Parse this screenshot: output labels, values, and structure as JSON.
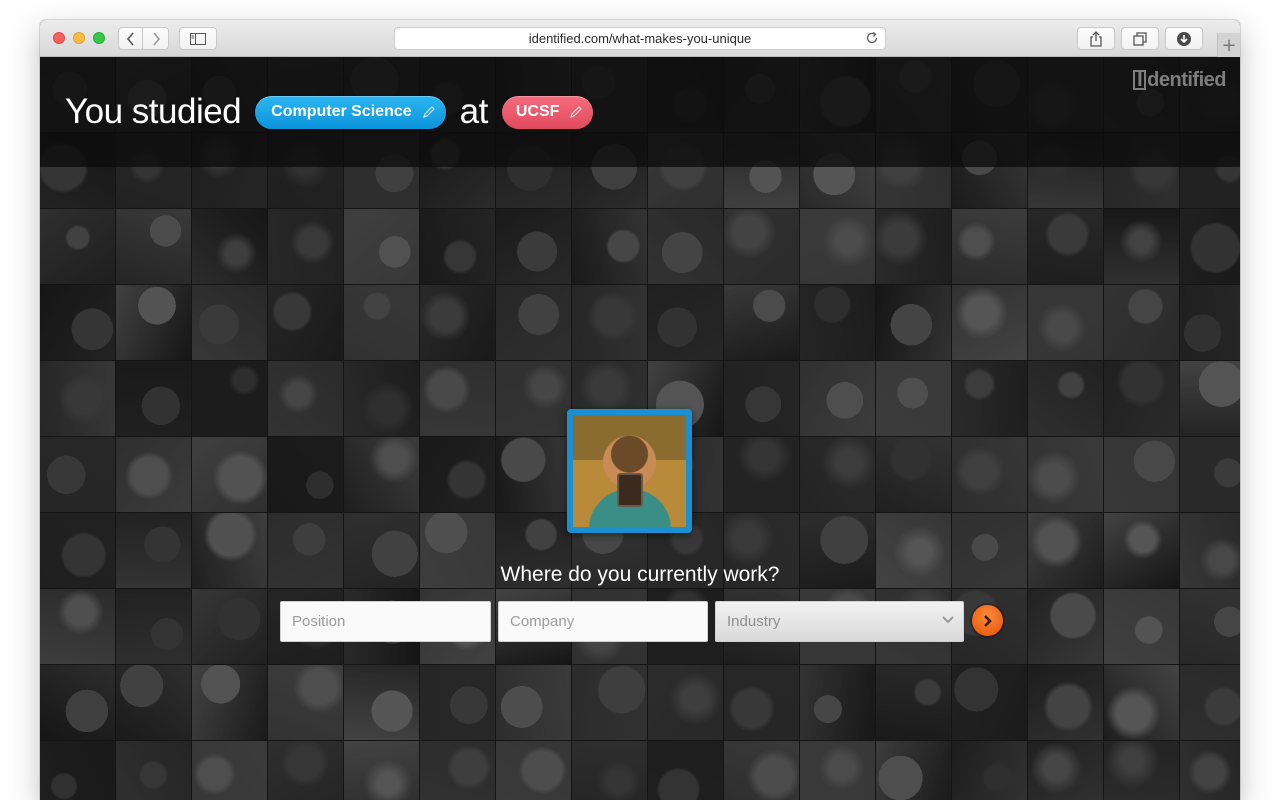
{
  "browser": {
    "url": "identified.com/what-makes-you-unique"
  },
  "brand": {
    "logo_text_prefix": "I",
    "logo_text_rest": "dentified"
  },
  "headline": {
    "prefix": "You studied",
    "field_of_study": "Computer Science",
    "connector": "at",
    "school": "UCSF"
  },
  "prompt": {
    "question": "Where do you currently work?"
  },
  "form": {
    "position_placeholder": "Position",
    "company_placeholder": "Company",
    "industry_selected": "Industry"
  },
  "colors": {
    "accent_blue": "#0c93da",
    "accent_red": "#e14a5e",
    "accent_orange": "#e45206"
  },
  "icons": {
    "pencil": "pencil-icon",
    "chevron": "chevron-down-icon",
    "arrow": "arrow-right-icon"
  }
}
